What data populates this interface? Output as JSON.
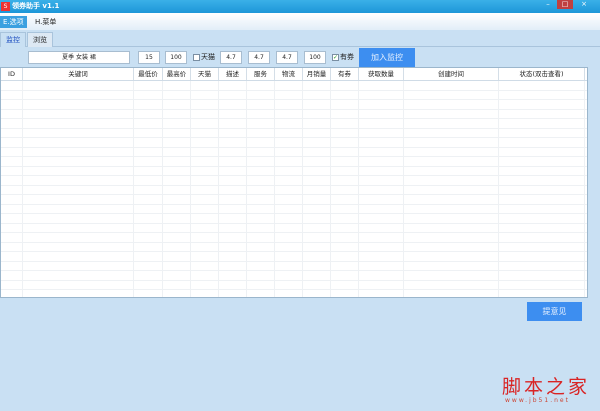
{
  "window": {
    "title": "领券助手 v1.1",
    "logo": "S",
    "minimize": "–",
    "maximize": "□",
    "close": "×"
  },
  "menu": [
    {
      "label": "E.选项"
    },
    {
      "label": "H.菜单"
    }
  ],
  "tabs": [
    {
      "label": "监控"
    },
    {
      "label": "浏览"
    }
  ],
  "toolbar": {
    "keyword": "夏季 女装 裙",
    "min_price": "15",
    "max_price": "100",
    "tmall_label": "天猫",
    "tmall_checked": false,
    "desc": "4.7",
    "service": "4.7",
    "logistics": "4.7",
    "monthly_sales": "100",
    "coupon_label": "有券",
    "coupon_checked": true,
    "add_button": "加入监控"
  },
  "table": {
    "columns": [
      "ID",
      "关键词",
      "最低价",
      "最高价",
      "天猫",
      "描述",
      "服务",
      "物流",
      "月销量",
      "有券",
      "获取数量",
      "创建时间",
      "状态(双击查看)"
    ],
    "rows": []
  },
  "feedback_button": "提意见",
  "watermark": {
    "text": "脚本之家",
    "url": "www.jb51.net"
  }
}
